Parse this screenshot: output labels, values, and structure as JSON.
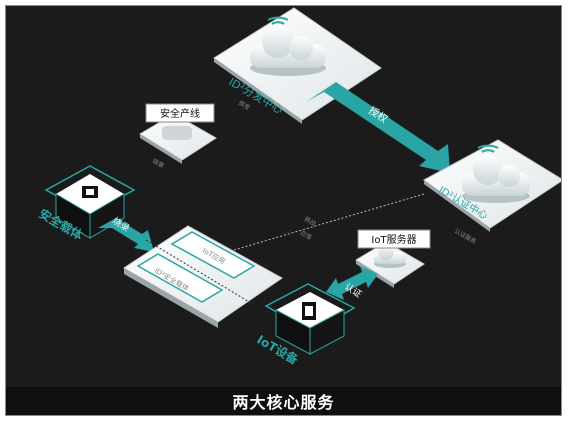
{
  "caption": "两大核心服务",
  "nodes": {
    "distribution_center": "ID²分发中心",
    "authentication_center": "ID²认证中心",
    "security_line": "安全产线",
    "security_carrier": "安全载体",
    "iot_device": "IoT设备",
    "iot_server": "IoT服务器",
    "iot_app": "IoT应用",
    "id2_security_carrier": "ID²安全载体"
  },
  "edges": {
    "authorize": "授权",
    "burn": "烧录",
    "certify": "认证"
  },
  "small_text": {
    "dist_sub": "颁发",
    "security_line_sub": "烧录",
    "auth_sub": "认证服务",
    "mid_1": "挑战",
    "mid_2": "应答"
  },
  "colors": {
    "accent": "#2aa5a5",
    "accent_light": "#6fd6d6",
    "background": "#1b1b1b",
    "tile": "#e9eef0"
  }
}
